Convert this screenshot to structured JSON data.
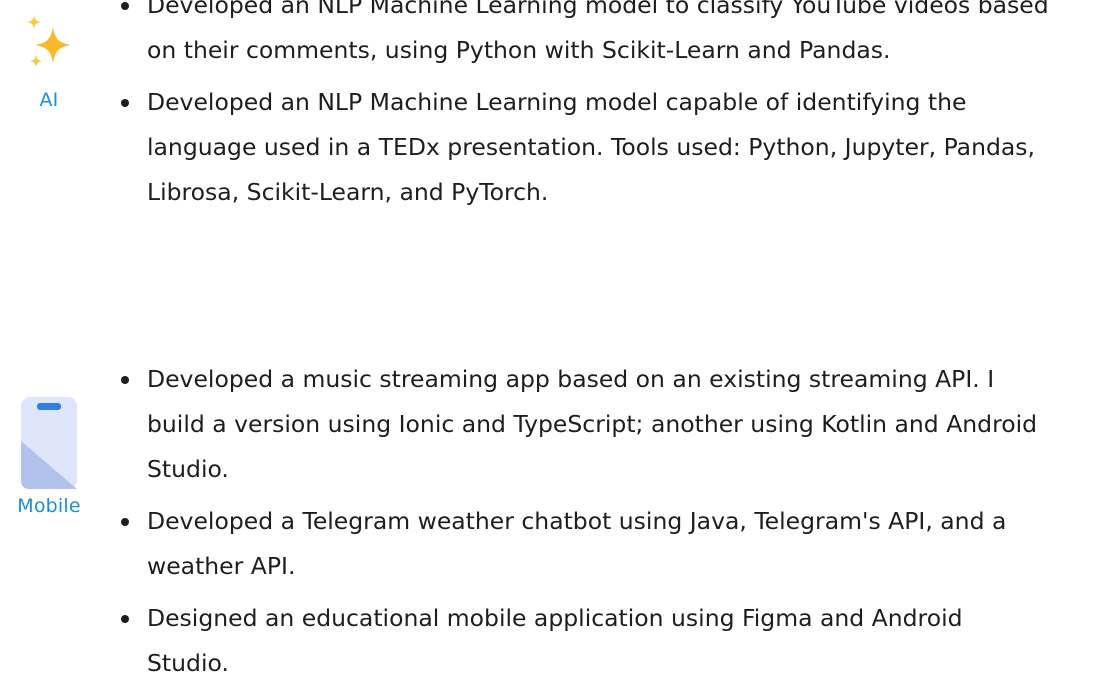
{
  "sections": [
    {
      "icon": "sparkles-icon",
      "label": "AI",
      "items": [
        "Developed an NLP Machine Learning model to classify YouTube videos based on their comments, using Python with Scikit-Learn and Pandas.",
        "Developed an NLP Machine Learning model capable of identifying the language used in a TEDx presentation. Tools used: Python, Jupyter, Pandas, Librosa, Scikit-Learn, and PyTorch."
      ]
    },
    {
      "icon": "mobile-phone-icon",
      "label": "Mobile",
      "items": [
        "Developed a music streaming app based on an existing streaming API. I build a version using Ionic and TypeScript; another using Kotlin and Android Studio.",
        "Developed a Telegram weather chatbot using Java, Telegram's API, and a weather API.",
        "Designed an educational mobile application using Figma and Android Studio."
      ]
    }
  ],
  "colors": {
    "label": "#1a8fd9",
    "sparkle": "#f7b928",
    "phone_body": "#dfe6fb",
    "phone_shade": "#b3c2ec",
    "phone_notch": "#2f7fe3",
    "text": "#1e1e1e"
  }
}
